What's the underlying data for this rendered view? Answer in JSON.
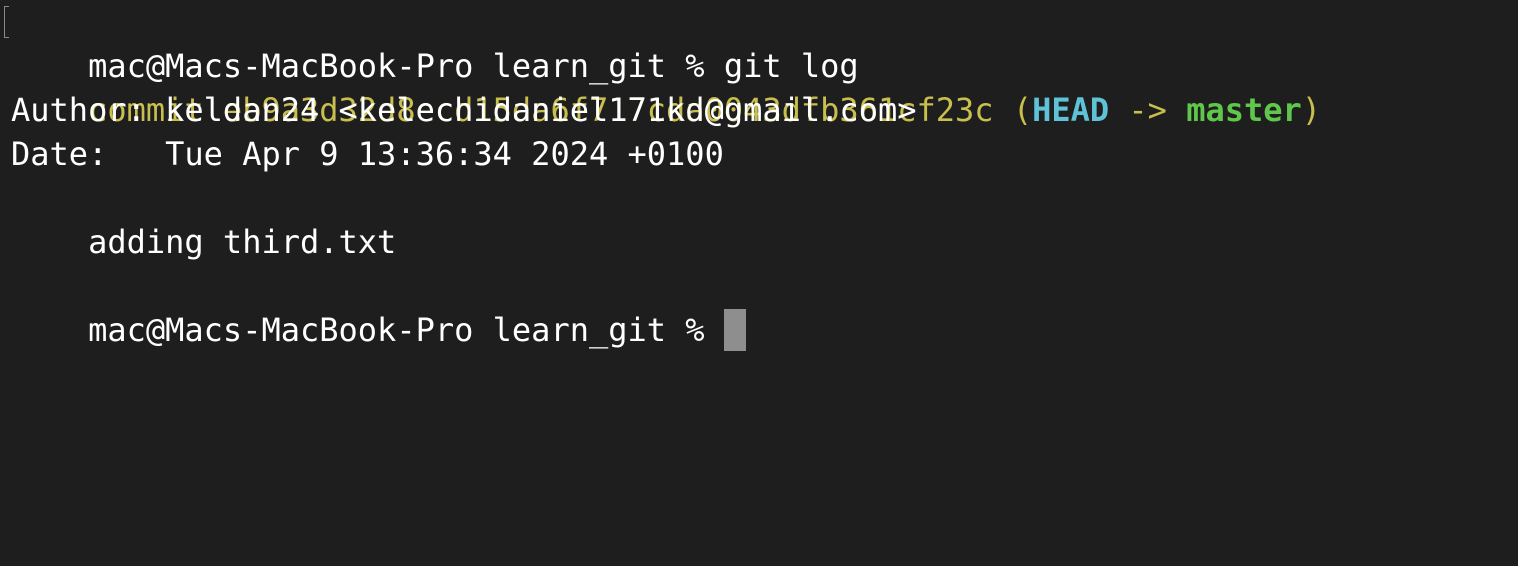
{
  "terminal": {
    "prompt": "mac@Macs-MacBook-Pro learn_git %",
    "command": "git log",
    "commit": {
      "label": "commit",
      "hash": "eb9a3d32d8ecd15da6f717cda0043dfb361cf23c",
      "ref_open": "(",
      "head": "HEAD",
      "arrow": "->",
      "branch": "master",
      "ref_close": ")"
    },
    "author_line": "Author: keldan24 <kelechidaniel171kd@gmail.com>",
    "date_line": "Date:   Tue Apr 9 13:36:34 2024 +0100",
    "message": "    adding third.txt",
    "next_prompt": "mac@Macs-MacBook-Pro learn_git %"
  },
  "colors": {
    "background": "#1e1e1e",
    "text": "#ffffff",
    "commit_yellow": "#c9bf4e",
    "head_cyan": "#5fc2d6",
    "branch_green": "#5fc84a",
    "cursor": "#8e8e8e"
  }
}
